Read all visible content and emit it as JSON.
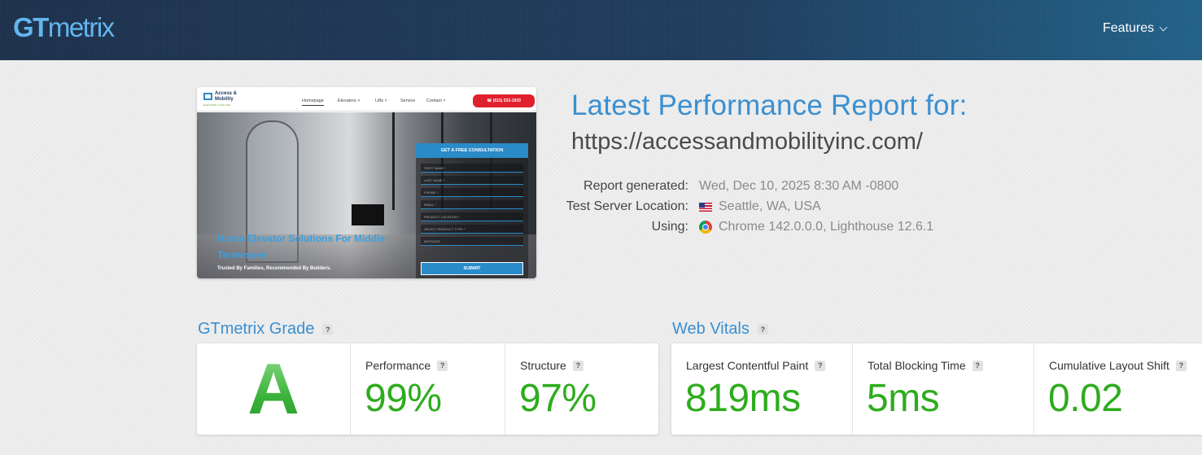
{
  "header": {
    "logo_bold": "GT",
    "logo_rest": "metrix",
    "nav_features": "Features"
  },
  "preview": {
    "logo_text": "Access & Mobility",
    "logo_sub": "ELEVATING YOUR LIFE",
    "nav": [
      "Homepage",
      "Elevators ˅",
      "Lifts ˅",
      "Service",
      "Contact ˅"
    ],
    "phone": "☎ (615) 533-1933",
    "headline": "Home Elevator Solutions For Middle Tennessee",
    "subline": "Trusted By Families, Recommended By Builders.",
    "form_title": "GET A FREE CONSULTATION",
    "fields": [
      "FIRST NAME *",
      "LAST NAME *",
      "PHONE *",
      "EMAIL *",
      "PRODUCT LOCATION *",
      "SELECT PRODUCT TYPE *",
      "MESSAGE"
    ],
    "submit": "SUBMIT"
  },
  "report": {
    "title": "Latest Performance Report for:",
    "url": "https://accessandmobilityinc.com/",
    "meta": [
      {
        "label": "Report generated:",
        "value": "Wed, Dec 10, 2025 8:30 AM -0800",
        "icon": ""
      },
      {
        "label": "Test Server Location:",
        "value": "Seattle, WA, USA",
        "icon": "us-flag-icon"
      },
      {
        "label": "Using:",
        "value": "Chrome 142.0.0.0, Lighthouse 12.6.1",
        "icon": "chrome-icon"
      }
    ]
  },
  "grade_section": {
    "title": "GTmetrix Grade",
    "help": "?",
    "grade": "A",
    "performance_label": "Performance",
    "performance_value": "99%",
    "structure_label": "Structure",
    "structure_value": "97%"
  },
  "vitals_section": {
    "title": "Web Vitals",
    "help": "?",
    "lcp_label": "Largest Contentful Paint",
    "lcp_value": "819ms",
    "tbt_label": "Total Blocking Time",
    "tbt_value": "5ms",
    "cls_label": "Cumulative Layout Shift",
    "cls_value": "0.02"
  },
  "colors": {
    "brand_blue": "#3a8fd1",
    "good_green": "#2eac1e",
    "header_bg": "#1c3553"
  }
}
